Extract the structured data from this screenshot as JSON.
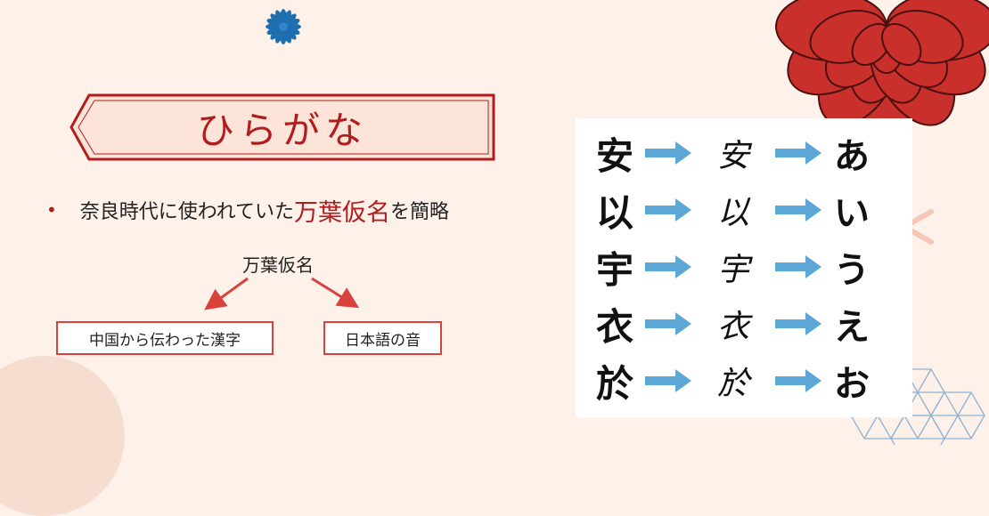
{
  "title": "ひらがな",
  "bullet": {
    "text_before": "奈良時代に使われていた",
    "highlight": "万葉仮名",
    "text_after": "を簡略"
  },
  "diagram": {
    "root": "万葉仮名",
    "left_box": "中国から伝わった漢字",
    "right_box": "日本語の音"
  },
  "kana_table": [
    {
      "kanji": "安",
      "cursive": "安",
      "hiragana": "あ"
    },
    {
      "kanji": "以",
      "cursive": "以",
      "hiragana": "い"
    },
    {
      "kanji": "宇",
      "cursive": "宇",
      "hiragana": "う"
    },
    {
      "kanji": "衣",
      "cursive": "衣",
      "hiragana": "え"
    },
    {
      "kanji": "於",
      "cursive": "於",
      "hiragana": "お"
    }
  ],
  "colors": {
    "accent": "#b11c1c",
    "arrow_blue": "#5aa7d8",
    "background": "#fdf1ea",
    "flower_red": "#c9302c",
    "flower_blue": "#1f6fb0"
  },
  "icons": {
    "kana_arrow": "right-arrow-icon",
    "decor_top": "blue-flower-icon",
    "decor_top_right": "red-chrysanthemum-icon"
  }
}
